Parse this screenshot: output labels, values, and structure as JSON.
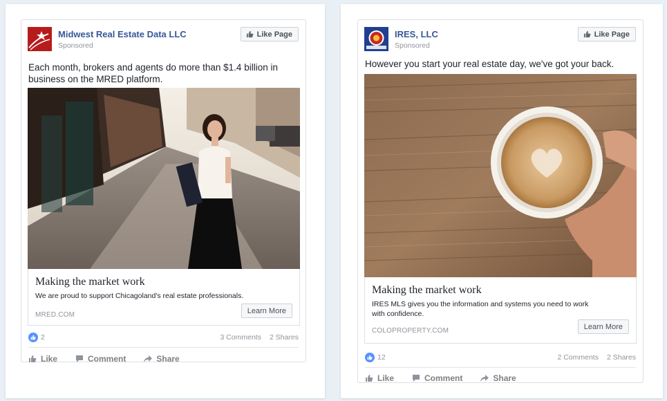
{
  "ads": [
    {
      "page_name": "Midwest Real Estate Data LLC",
      "sponsored": "Sponsored",
      "like_page_label": "Like Page",
      "post_text": "Each month, brokers and agents do more than $1.4 billion in business on the MRED platform.",
      "link_title": "Making the market work",
      "link_description": "We are proud to support Chicagoland's real estate professionals.",
      "link_domain": "MRED.COM",
      "cta_label": "Learn More",
      "likes": "2",
      "comments": "3 Comments",
      "shares": "2 Shares",
      "actions": {
        "like": "Like",
        "comment": "Comment",
        "share": "Share"
      }
    },
    {
      "page_name": "IRES, LLC",
      "sponsored": "Sponsored",
      "like_page_label": "Like Page",
      "post_text": "However you start your real estate day, we've got your back.",
      "link_title": "Making the market work",
      "link_description": "IRES MLS gives you the information and systems you need to work with confidence.",
      "link_domain": "COLOPROPERTY.COM",
      "cta_label": "Learn More",
      "likes": "12",
      "comments": "2 Comments",
      "shares": "2 Shares",
      "actions": {
        "like": "Like",
        "comment": "Comment",
        "share": "Share"
      }
    }
  ],
  "colors": {
    "page_background": "#e9f0f5",
    "link_blue": "#365899",
    "like_badge": "#5890ff",
    "muted_text": "#90949c"
  },
  "icons": [
    "thumbs-up-icon",
    "comment-icon",
    "share-icon",
    "mred-logo",
    "ires-logo"
  ]
}
